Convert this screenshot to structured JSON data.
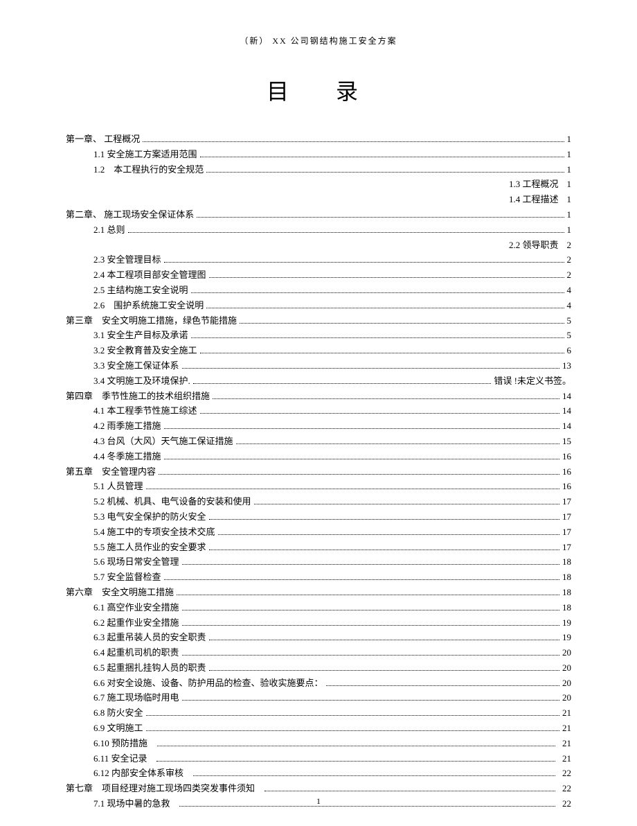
{
  "docHeader": "（新） XX 公司钢结构施工安全方案",
  "mainTitle": "目　录",
  "footerPage": "1",
  "toc": [
    {
      "level": 1,
      "num": "第一章、",
      "title": "工程概况",
      "page": "1",
      "type": "dots"
    },
    {
      "level": 2,
      "num": "1.1",
      "title": "安全施工方案适用范围",
      "page": "1",
      "type": "dots"
    },
    {
      "level": 2,
      "num": "1.2",
      "title": "本工程执行的安全规范",
      "page": "1",
      "type": "dots",
      "extraSpace": true
    },
    {
      "level": 2,
      "num": "1.3",
      "title": "工程概况",
      "page": "1",
      "type": "right"
    },
    {
      "level": 2,
      "num": "1.4",
      "title": "工程描述",
      "page": "1",
      "type": "right"
    },
    {
      "level": 1,
      "num": "第二章、",
      "title": "施工现场安全保证体系",
      "page": "1",
      "type": "dots"
    },
    {
      "level": 2,
      "num": "2.1",
      "title": "总则",
      "page": "1",
      "type": "dots"
    },
    {
      "level": 2,
      "num": "2.2",
      "title": "领导职责",
      "page": "2",
      "type": "right"
    },
    {
      "level": 2,
      "num": "2.3",
      "title": "安全管理目标",
      "page": "2",
      "type": "dots"
    },
    {
      "level": 2,
      "num": "2.4",
      "title": "本工程项目部安全管理图",
      "page": "2",
      "type": "dots"
    },
    {
      "level": 2,
      "num": "2.5",
      "title": "主结构施工安全说明",
      "page": "4",
      "type": "dots"
    },
    {
      "level": 2,
      "num": "2.6",
      "title": "围护系统施工安全说明",
      "page": "4",
      "type": "dots",
      "extraSpace": true
    },
    {
      "level": 1,
      "num": "第三章",
      "title": "安全文明施工措施，绿色节能措施",
      "page": "5",
      "type": "dots",
      "extraSpace": true
    },
    {
      "level": 2,
      "num": "3.1",
      "title": "安全生产目标及承诺",
      "page": "5",
      "type": "dots"
    },
    {
      "level": 2,
      "num": "3.2",
      "title": "安全教育普及安全施工",
      "page": "6",
      "type": "dots"
    },
    {
      "level": 2,
      "num": "3.3",
      "title": "安全施工保证体系",
      "page": "13",
      "type": "dots"
    },
    {
      "level": 2,
      "num": "3.4",
      "title": "文明施工及环境保护.",
      "page": "错误 !未定义书签。",
      "type": "dots"
    },
    {
      "level": 1,
      "num": "第四章",
      "title": "季节性施工的技术组织措施",
      "page": "14",
      "type": "dots",
      "extraSpace": true
    },
    {
      "level": 2,
      "num": "4.1",
      "title": "本工程季节性施工综述",
      "page": "14",
      "type": "dots"
    },
    {
      "level": 2,
      "num": "4.2",
      "title": "雨季施工措施",
      "page": "14",
      "type": "dots"
    },
    {
      "level": 2,
      "num": "4.3",
      "title": "台风（大风）天气施工保证措施",
      "page": "15",
      "type": "dots"
    },
    {
      "level": 2,
      "num": "4.4",
      "title": "冬季施工措施",
      "page": "16",
      "type": "dots"
    },
    {
      "level": 1,
      "num": "第五章",
      "title": "安全管理内容",
      "page": "16",
      "type": "dots",
      "extraSpace": true
    },
    {
      "level": 2,
      "num": "5.1",
      "title": "人员管理",
      "page": "16",
      "type": "dots"
    },
    {
      "level": 2,
      "num": "5.2",
      "title": "机械、机具、电气设备的安装和使用",
      "page": "17",
      "type": "dots"
    },
    {
      "level": 2,
      "num": "5.3",
      "title": "电气安全保护的防火安全",
      "page": "17",
      "type": "dots"
    },
    {
      "level": 2,
      "num": "5.4",
      "title": "施工中的专项安全技术交底",
      "page": "17",
      "type": "dots"
    },
    {
      "level": 2,
      "num": "5.5",
      "title": "施工人员作业的安全要求",
      "page": "17",
      "type": "dots"
    },
    {
      "level": 2,
      "num": "5.6",
      "title": "现场日常安全管理",
      "page": "18",
      "type": "dots"
    },
    {
      "level": 2,
      "num": "5.7",
      "title": "安全监督检查",
      "page": "18",
      "type": "dots"
    },
    {
      "level": 1,
      "num": "第六章",
      "title": "安全文明施工措施",
      "page": "18",
      "type": "dots",
      "extraSpace": true
    },
    {
      "level": 2,
      "num": "6.1",
      "title": "高空作业安全措施",
      "page": "18",
      "type": "dots"
    },
    {
      "level": 2,
      "num": "6.2",
      "title": "起重作业安全措施",
      "page": "19",
      "type": "dots"
    },
    {
      "level": 2,
      "num": "6.3",
      "title": "起重吊装人员的安全职责",
      "page": "19",
      "type": "dots"
    },
    {
      "level": 2,
      "num": "6.4",
      "title": "起重机司机的职责",
      "page": "20",
      "type": "dots"
    },
    {
      "level": 2,
      "num": "6.5",
      "title": "起重捆扎挂钩人员的职责",
      "page": "20",
      "type": "dots"
    },
    {
      "level": 2,
      "num": "6.6",
      "title": "对安全设施、设备、防护用品的检查、验收实施要点：",
      "page": "20",
      "type": "dots"
    },
    {
      "level": 2,
      "num": "6.7",
      "title": "施工现场临时用电",
      "page": "20",
      "type": "dots"
    },
    {
      "level": 2,
      "num": "6.8",
      "title": "防火安全",
      "page": "21",
      "type": "dots"
    },
    {
      "level": 2,
      "num": "6.9",
      "title": "文明施工",
      "page": "21",
      "type": "dots"
    },
    {
      "level": 2,
      "num": "6.10",
      "title": "预防措施",
      "page": "21",
      "type": "dots-gap"
    },
    {
      "level": 2,
      "num": "6.11",
      "title": "安全记录",
      "page": "21",
      "type": "dots-gap"
    },
    {
      "level": 2,
      "num": "6.12",
      "title": "内部安全体系审核",
      "page": "22",
      "type": "dots-gap"
    },
    {
      "level": 1,
      "num": "第七章",
      "title": "项目经理对施工现场四类突发事件须知",
      "page": "22",
      "type": "dots-gap",
      "extraSpace": true
    },
    {
      "level": 2,
      "num": "7.1",
      "title": "现场中暑的急救",
      "page": "22",
      "type": "dots-gap"
    }
  ]
}
